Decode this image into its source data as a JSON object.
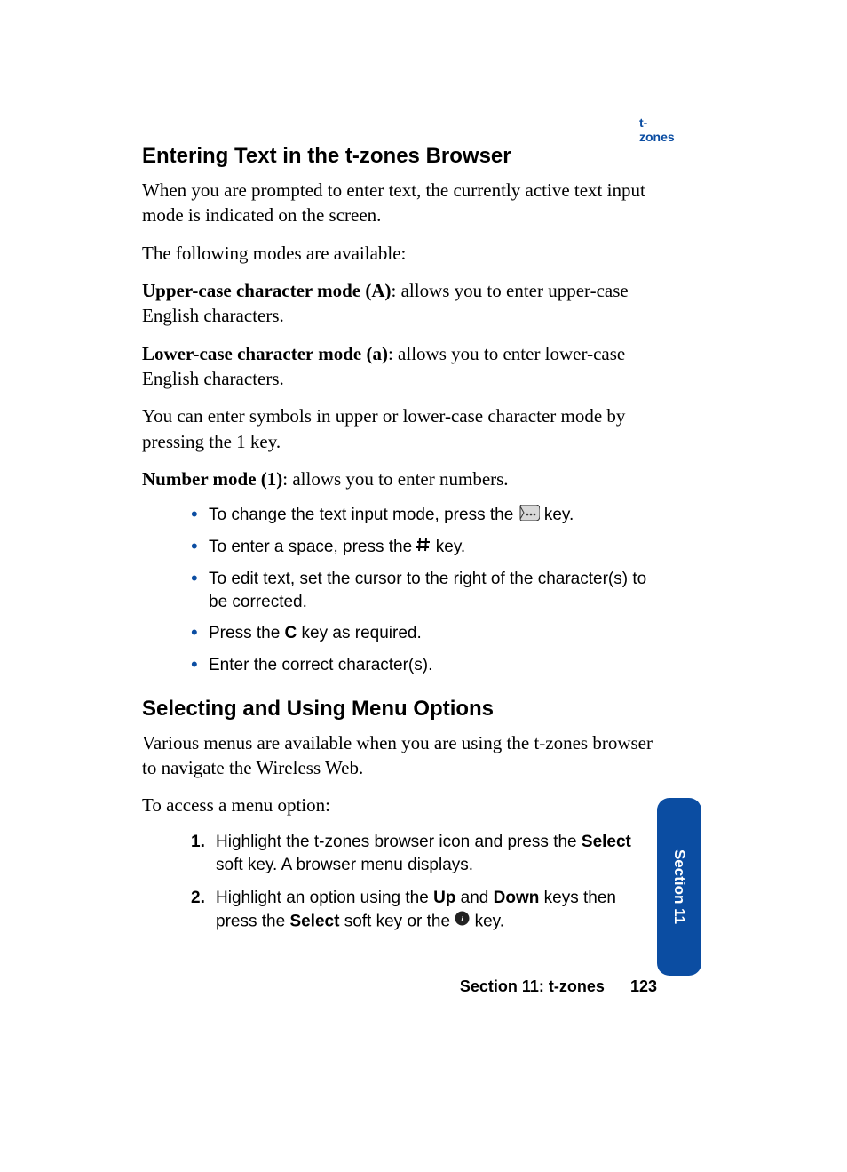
{
  "header": {
    "running": "t-zones"
  },
  "sections": {
    "entering": {
      "heading": "Entering Text in the t-zones Browser",
      "p1": "When you are prompted to enter text, the currently active text input mode is indicated on the screen.",
      "p2": "The following modes are available:",
      "upper_label": "Upper-case character mode (A)",
      "upper_rest": ": allows you to enter upper-case English characters.",
      "lower_label": "Lower-case character mode (a)",
      "lower_rest": ": allows you to enter lower-case English characters.",
      "symbols": "You can enter symbols in upper or lower-case character mode by pressing the 1 key.",
      "number_label": "Number mode (1)",
      "number_rest": ": allows you to enter numbers.",
      "bullets": {
        "b1a": "To change the text input mode, press the ",
        "b1b": " key.",
        "b2a": "To enter a space, press the ",
        "b2b": " key.",
        "b3": "To edit text, set the cursor to the right of the character(s) to be corrected.",
        "b4a": "Press the ",
        "b4_key": "C",
        "b4b": " key as required.",
        "b5": "Enter the correct character(s)."
      }
    },
    "selecting": {
      "heading": "Selecting and Using Menu Options",
      "p1": "Various menus are available when you are using the t-zones browser to navigate the Wireless Web.",
      "p2": "To access a menu option:",
      "steps": {
        "s1_num": "1.",
        "s1a": "Highlight the t-zones browser icon and press the ",
        "s1_key": "Select",
        "s1b": " soft key. A browser menu displays.",
        "s2_num": "2.",
        "s2a": "Highlight an option using the ",
        "s2_up": "Up",
        "s2_mid": " and ",
        "s2_down": "Down",
        "s2b": " keys then press the ",
        "s2_select": "Select",
        "s2c": " soft key or the ",
        "s2d": " key."
      }
    }
  },
  "footer": {
    "section_label": "Section 11: t-zones",
    "page_number": "123"
  },
  "tab": {
    "label": "Section 11"
  }
}
